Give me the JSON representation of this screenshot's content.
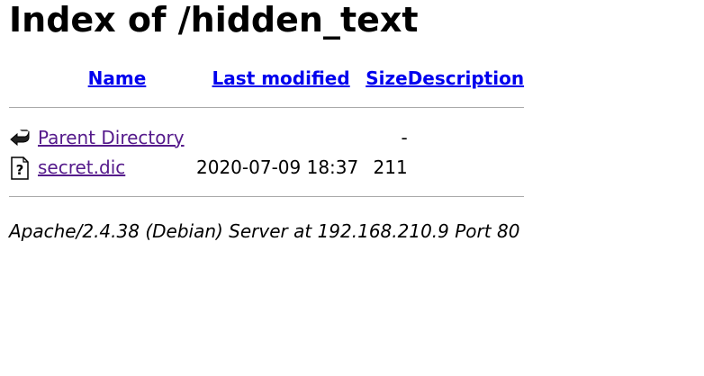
{
  "page": {
    "title": "Index of /hidden_text"
  },
  "columns": {
    "name": "Name",
    "last_modified": "Last modified",
    "size": "Size",
    "description": "Description"
  },
  "rows": [
    {
      "icon": "back-icon",
      "name": "Parent Directory",
      "last_modified": "",
      "size": "-",
      "description": ""
    },
    {
      "icon": "unknown-file-icon",
      "name": "secret.dic",
      "last_modified": "2020-07-09 18:37",
      "size": "211",
      "description": ""
    }
  ],
  "footer": {
    "address": "Apache/2.4.38 (Debian) Server at 192.168.210.9 Port 80"
  },
  "colors": {
    "link": "#0000ee",
    "visited_link": "#551a8b",
    "rule": "#aaaaaa"
  }
}
